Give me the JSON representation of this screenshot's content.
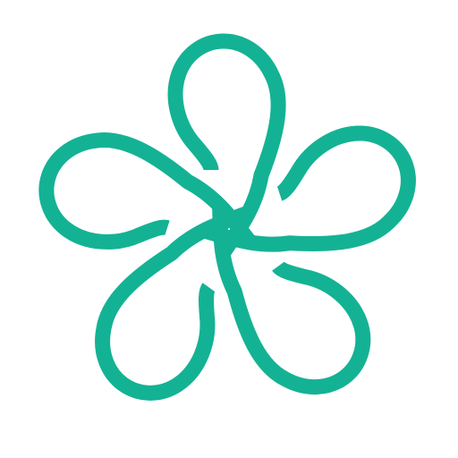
{
  "logo": {
    "icon": "five-petal-flower-knot-icon",
    "stroke_color": "#14b294",
    "background_color": "#ffffff",
    "petal_count": 5
  }
}
